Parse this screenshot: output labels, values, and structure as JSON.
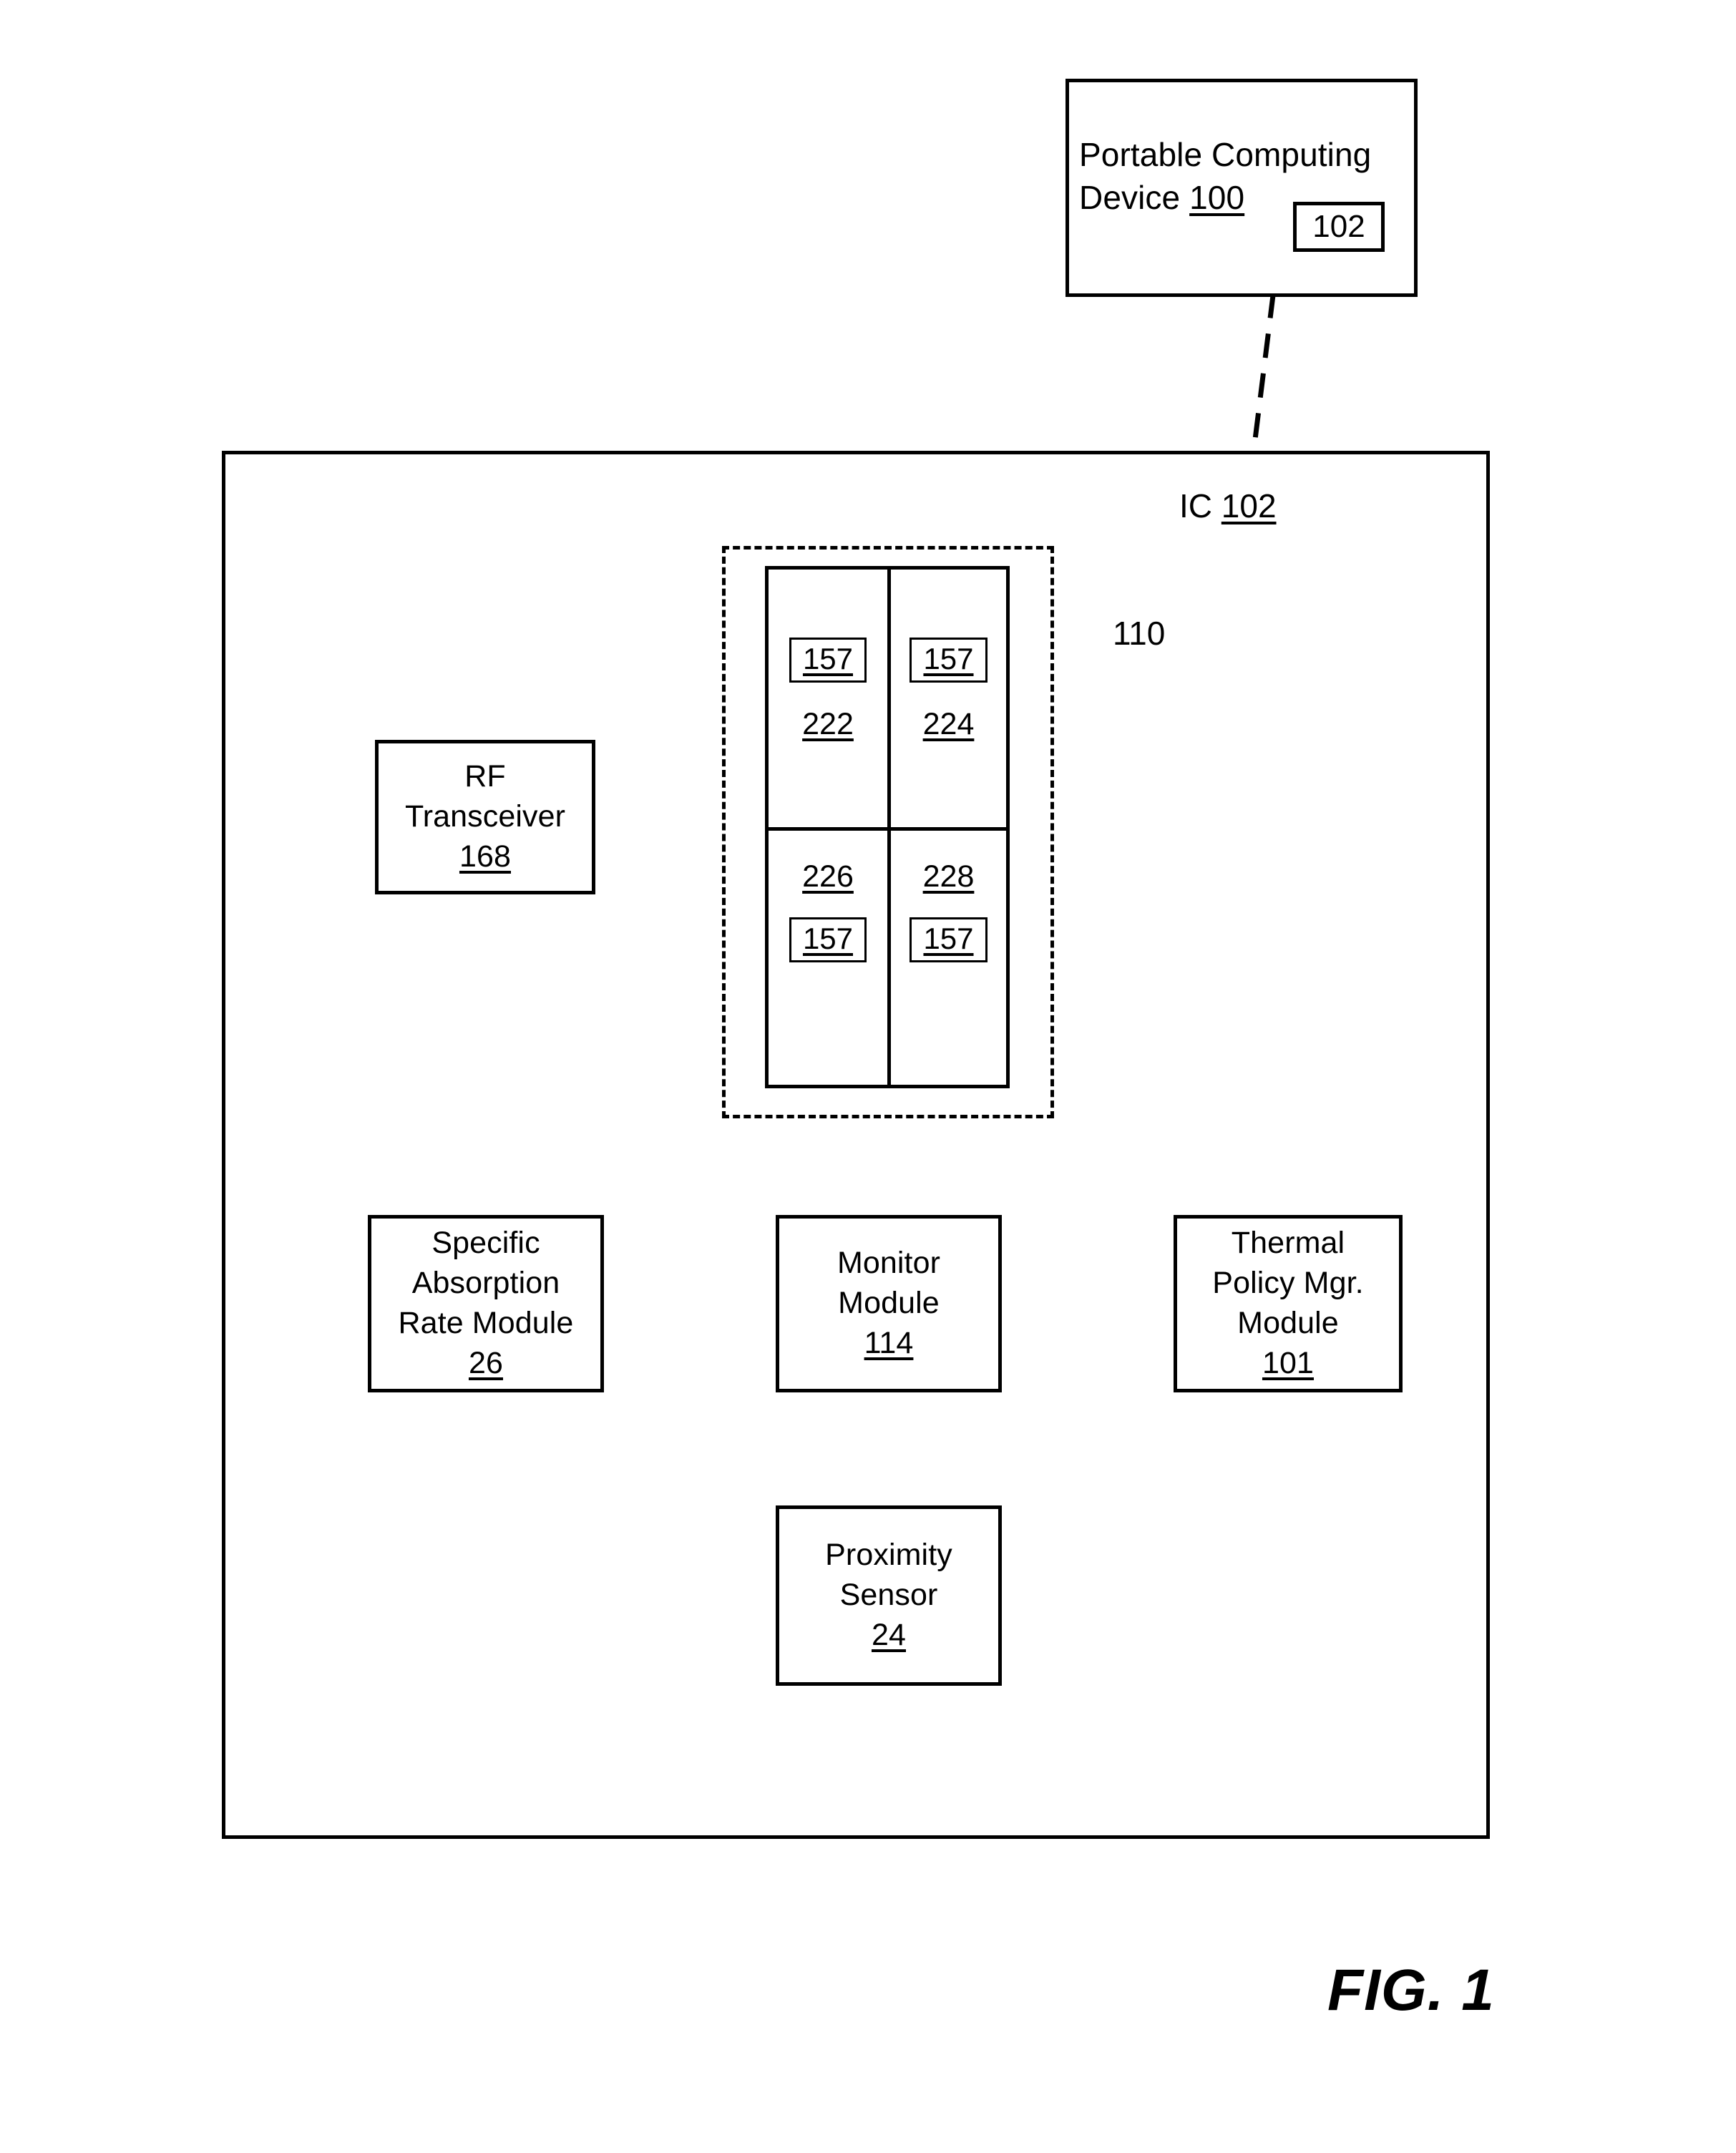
{
  "figure": {
    "label": "FIG. 1"
  },
  "portable_device": {
    "title_line1": "Portable Computing",
    "title_line2": "Device",
    "ref": "100",
    "chip_ref": "102"
  },
  "ic": {
    "prefix": "IC",
    "ref": "102"
  },
  "core_group": {
    "callout": "110",
    "cells": [
      {
        "ref": "222",
        "sensor": "157",
        "sensor_position": "top"
      },
      {
        "ref": "224",
        "sensor": "157",
        "sensor_position": "top"
      },
      {
        "ref": "226",
        "sensor": "157",
        "sensor_position": "bottom"
      },
      {
        "ref": "228",
        "sensor": "157",
        "sensor_position": "bottom"
      }
    ]
  },
  "blocks": {
    "rf_transceiver": {
      "line1": "RF",
      "line2": "Transceiver",
      "ref": "168"
    },
    "specific_absorption_rate": {
      "line1": "Specific",
      "line2": "Absorption",
      "line3": "Rate Module",
      "ref": "26"
    },
    "monitor": {
      "line1": "Monitor",
      "line2": "Module",
      "ref": "114"
    },
    "thermal_policy_manager": {
      "line1": "Thermal",
      "line2": "Policy Mgr.",
      "line3": "Module",
      "ref": "101"
    },
    "proximity_sensor": {
      "line1": "Proximity",
      "line2": "Sensor",
      "ref": "24"
    }
  },
  "colors": {
    "stroke": "#000000",
    "background": "#ffffff"
  }
}
